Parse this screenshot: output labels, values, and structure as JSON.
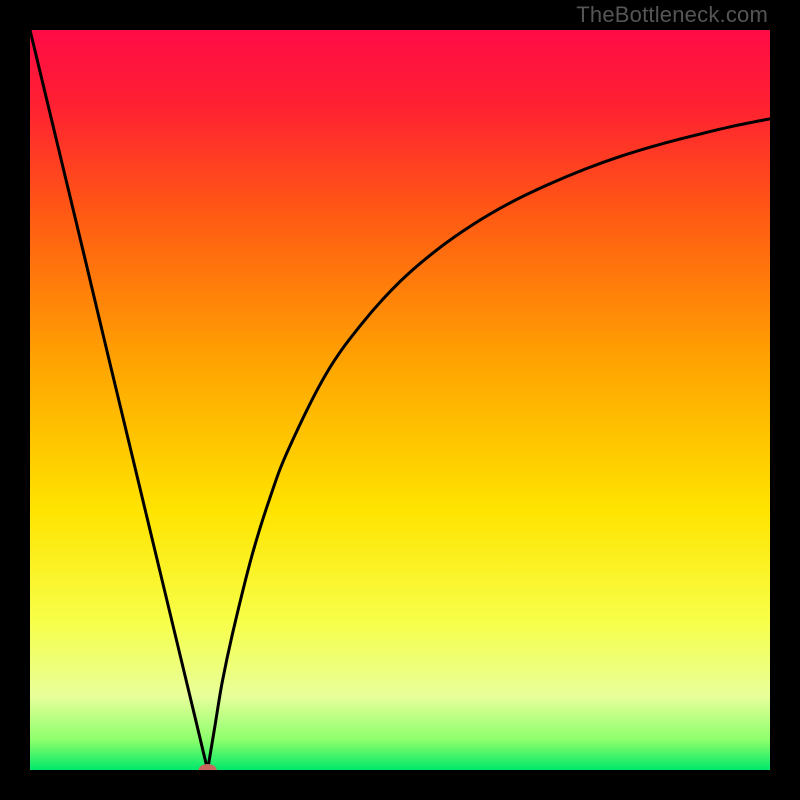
{
  "watermark": "TheBottleneck.com",
  "chart_data": {
    "type": "line",
    "title": "",
    "xlabel": "",
    "ylabel": "",
    "xlim": [
      0,
      100
    ],
    "ylim": [
      0,
      100
    ],
    "grid": false,
    "legend": false,
    "gradient_stops": [
      {
        "offset": 0.0,
        "color": "#ff0b46"
      },
      {
        "offset": 0.1,
        "color": "#ff2032"
      },
      {
        "offset": 0.25,
        "color": "#ff5a13"
      },
      {
        "offset": 0.45,
        "color": "#ffa401"
      },
      {
        "offset": 0.65,
        "color": "#ffe400"
      },
      {
        "offset": 0.8,
        "color": "#f7ff4a"
      },
      {
        "offset": 0.9,
        "color": "#e8ff9a"
      },
      {
        "offset": 0.96,
        "color": "#8bff6b"
      },
      {
        "offset": 1.0,
        "color": "#00e86b"
      }
    ],
    "series": [
      {
        "name": "left-branch",
        "x": [
          0.0,
          2.5,
          5.0,
          7.5,
          10.0,
          12.5,
          15.0,
          17.5,
          20.0,
          22.5,
          24.0
        ],
        "y": [
          100.0,
          89.6,
          79.2,
          68.8,
          58.3,
          47.9,
          37.5,
          27.1,
          16.7,
          6.3,
          0.0
        ]
      },
      {
        "name": "right-branch",
        "x": [
          24.0,
          25.0,
          26.0,
          27.5,
          30.0,
          32.5,
          35.0,
          40.0,
          45.0,
          50.0,
          55.0,
          60.0,
          65.0,
          70.0,
          75.0,
          80.0,
          85.0,
          90.0,
          95.0,
          100.0
        ],
        "y": [
          0.0,
          6.0,
          12.0,
          19.0,
          29.0,
          37.0,
          43.5,
          53.5,
          60.5,
          66.0,
          70.3,
          73.8,
          76.7,
          79.1,
          81.2,
          83.0,
          84.5,
          85.8,
          87.0,
          88.0
        ]
      }
    ],
    "highlight_point": {
      "x": 24.0,
      "y": 0.0,
      "color": "#c9675f"
    }
  }
}
